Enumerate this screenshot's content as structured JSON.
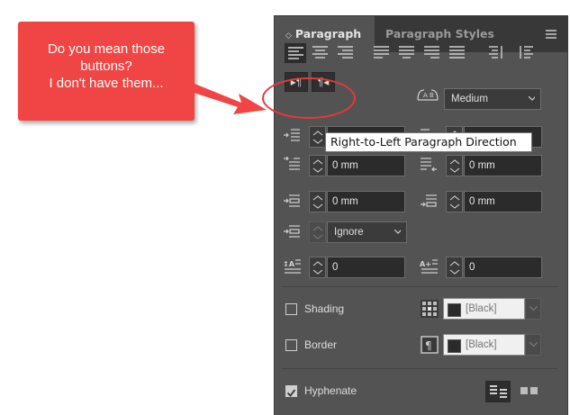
{
  "callout": {
    "lines": [
      "Do you mean those",
      "buttons?",
      "I don't have them..."
    ],
    "color": "#f04545"
  },
  "panel": {
    "tabs": [
      {
        "label": "Paragraph",
        "active": true
      },
      {
        "label": "Paragraph Styles",
        "active": false
      }
    ],
    "tab_chevron": "◇",
    "menu_icon": "hamburger-menu-icon",
    "alignment_buttons": [
      "align-left",
      "align-center",
      "align-right",
      "justify-left",
      "justify-center",
      "justify-right",
      "justify-all",
      "align-towards-spine",
      "align-away-from-spine"
    ],
    "direction_buttons": {
      "ltr_glyph": "▸¶",
      "rtl_glyph": "¶◂"
    },
    "composer": {
      "value": "Medium"
    },
    "tooltip": "Right-to-Left Paragraph Direction",
    "fields": {
      "left_indent": "",
      "right_indent": "",
      "first_line_indent": "0 mm",
      "last_line_right_indent": "0 mm",
      "space_before": "0 mm",
      "space_after": "0 mm",
      "align_to_grid": "Ignore",
      "drop_cap_lines": "0",
      "drop_cap_chars": "0"
    },
    "shading": {
      "label": "Shading",
      "checked": false,
      "color": "[Black]"
    },
    "border": {
      "label": "Border",
      "checked": false,
      "color": "[Black]"
    },
    "hyphenate": {
      "label": "Hyphenate",
      "checked": true
    }
  }
}
